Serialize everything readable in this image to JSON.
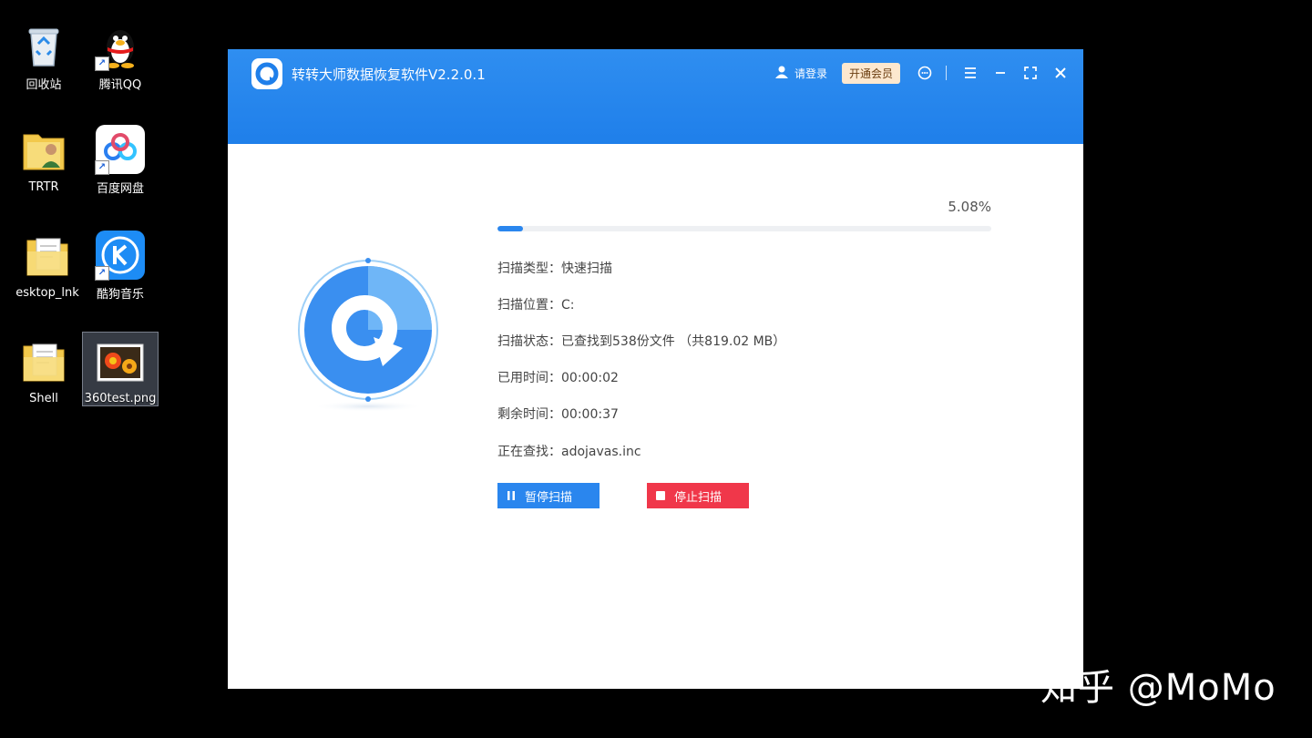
{
  "desktop": {
    "icons": [
      {
        "label": "回收站"
      },
      {
        "label": "腾讯QQ"
      },
      {
        "label": "TRTR"
      },
      {
        "label": "百度网盘"
      },
      {
        "label": "esktop_lnk"
      },
      {
        "label": "酷狗音乐"
      },
      {
        "label": "Shell"
      },
      {
        "label": "360test.png"
      }
    ]
  },
  "window": {
    "title": "转转大师数据恢复软件V2.2.0.1",
    "toolbar": {
      "login_label": "请登录",
      "vip_label": "开通会员"
    },
    "scan": {
      "percent_text": "5.08%",
      "progress": 0.0508,
      "rows": [
        {
          "key": "扫描类型：",
          "value": "快速扫描"
        },
        {
          "key": "扫描位置：",
          "value": "C:"
        },
        {
          "key": "扫描状态：",
          "value": "已查找到538份文件 （共819.02 MB）"
        },
        {
          "key": "已用时间：",
          "value": "00:00:02"
        },
        {
          "key": "剩余时间：",
          "value": "00:00:37"
        },
        {
          "key": "正在查找：",
          "value": "adojavas.inc"
        }
      ],
      "pause_label": "暂停扫描",
      "stop_label": "停止扫描"
    }
  },
  "watermark": "知乎 @MoMo",
  "colors": {
    "header_blue": "#1f7fea",
    "progress_blue": "#2a86ee",
    "stop_red": "#f0374a",
    "vip_bg": "#fde8cf"
  }
}
